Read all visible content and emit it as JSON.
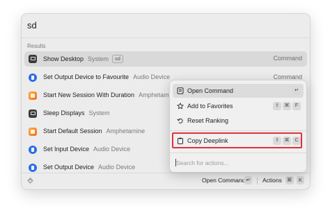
{
  "search": {
    "query": "sd"
  },
  "section_label": "Results",
  "results": [
    {
      "title": "Show Desktop",
      "subtitle": "System",
      "badge": "sd",
      "accessory": "Command",
      "icon": "monitor-icon",
      "selected": true
    },
    {
      "title": "Set Output Device to Favourite",
      "subtitle": "Audio Device",
      "accessory": "Command",
      "icon": "audio-device-icon"
    },
    {
      "title": "Start New Session With Duration",
      "subtitle": "Amphetamine",
      "accessory": "",
      "icon": "amphetamine-icon"
    },
    {
      "title": "Sleep Displays",
      "subtitle": "System",
      "accessory": "",
      "icon": "monitor-icon"
    },
    {
      "title": "Start Default Session",
      "subtitle": "Amphetamine",
      "accessory": "",
      "icon": "amphetamine-icon"
    },
    {
      "title": "Set Input Device",
      "subtitle": "Audio Device",
      "accessory": "",
      "icon": "audio-device-icon"
    },
    {
      "title": "Set Output Device",
      "subtitle": "Audio Device",
      "accessory": "",
      "icon": "audio-device-icon"
    }
  ],
  "footer": {
    "primary_action": "Open Command",
    "primary_key": "↵",
    "actions_label": "Actions",
    "actions_keys": [
      "⌘",
      "K"
    ]
  },
  "action_panel": {
    "items": [
      {
        "label": "Open Command",
        "icon": "document-icon",
        "keys": [
          "↵"
        ],
        "selected": true
      },
      {
        "label": "Add to Favorites",
        "icon": "star-icon",
        "keys": [
          "⇧",
          "⌘",
          "F"
        ]
      },
      {
        "label": "Reset Ranking",
        "icon": "undo-icon",
        "keys": []
      }
    ],
    "highlighted_item": {
      "label": "Copy Deeplink",
      "icon": "clipboard-icon",
      "keys": [
        "⇧",
        "⌘",
        "C"
      ]
    },
    "search_placeholder": "Search for actions..."
  },
  "colors": {
    "highlight_border": "#e0323a",
    "selection": "#d9d9d9",
    "window_bg": "#ececec"
  }
}
